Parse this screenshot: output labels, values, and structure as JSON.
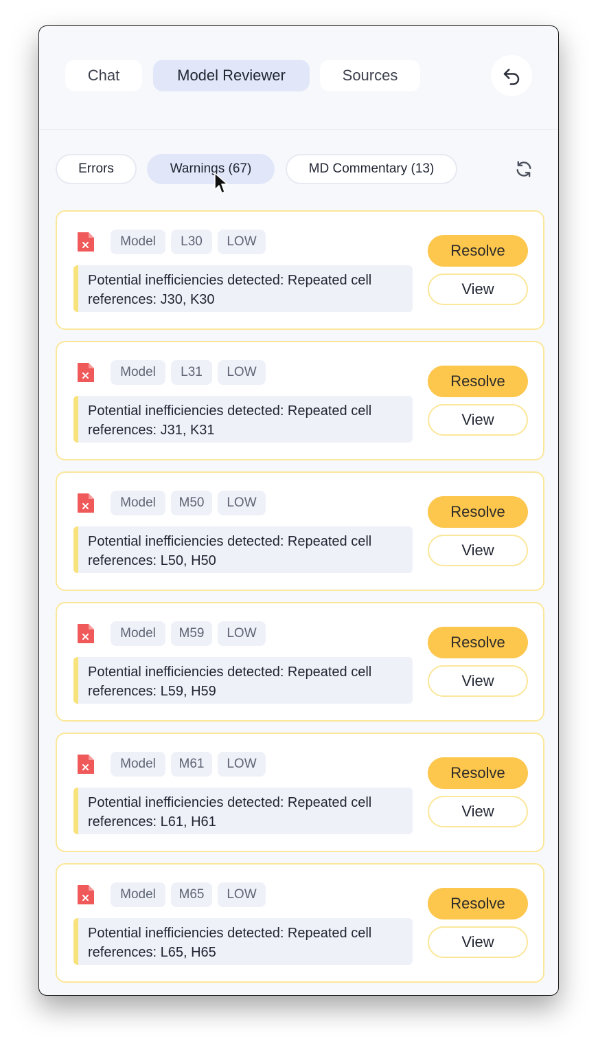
{
  "tabs": [
    {
      "label": "Chat",
      "active": false
    },
    {
      "label": "Model Reviewer",
      "active": true
    },
    {
      "label": "Sources",
      "active": false
    }
  ],
  "back_icon": "undo-arrow-icon",
  "filters": [
    {
      "label": "Errors",
      "active": false
    },
    {
      "label": "Warnings (67)",
      "active": true
    },
    {
      "label": "MD Commentary (13)",
      "active": false
    }
  ],
  "refresh_icon": "refresh-icon",
  "colors": {
    "accent": "#fdc64c",
    "card_border": "#fbe79a",
    "active_tab": "#e1e7f8",
    "file_error": "#f0595a"
  },
  "items": [
    {
      "source": "Model",
      "cell": "L30",
      "severity": "LOW",
      "message": "Potential inefficiencies detected: Repeated cell references: J30, K30",
      "resolve_label": "Resolve",
      "view_label": "View"
    },
    {
      "source": "Model",
      "cell": "L31",
      "severity": "LOW",
      "message": "Potential inefficiencies detected: Repeated cell references: J31, K31",
      "resolve_label": "Resolve",
      "view_label": "View"
    },
    {
      "source": "Model",
      "cell": "M50",
      "severity": "LOW",
      "message": "Potential inefficiencies detected: Repeated cell references: L50, H50",
      "resolve_label": "Resolve",
      "view_label": "View"
    },
    {
      "source": "Model",
      "cell": "M59",
      "severity": "LOW",
      "message": "Potential inefficiencies detected: Repeated cell references: L59, H59",
      "resolve_label": "Resolve",
      "view_label": "View"
    },
    {
      "source": "Model",
      "cell": "M61",
      "severity": "LOW",
      "message": "Potential inefficiencies detected: Repeated cell references: L61, H61",
      "resolve_label": "Resolve",
      "view_label": "View"
    },
    {
      "source": "Model",
      "cell": "M65",
      "severity": "LOW",
      "message": "Potential inefficiencies detected: Repeated cell references: L65, H65",
      "resolve_label": "Resolve",
      "view_label": "View"
    }
  ]
}
